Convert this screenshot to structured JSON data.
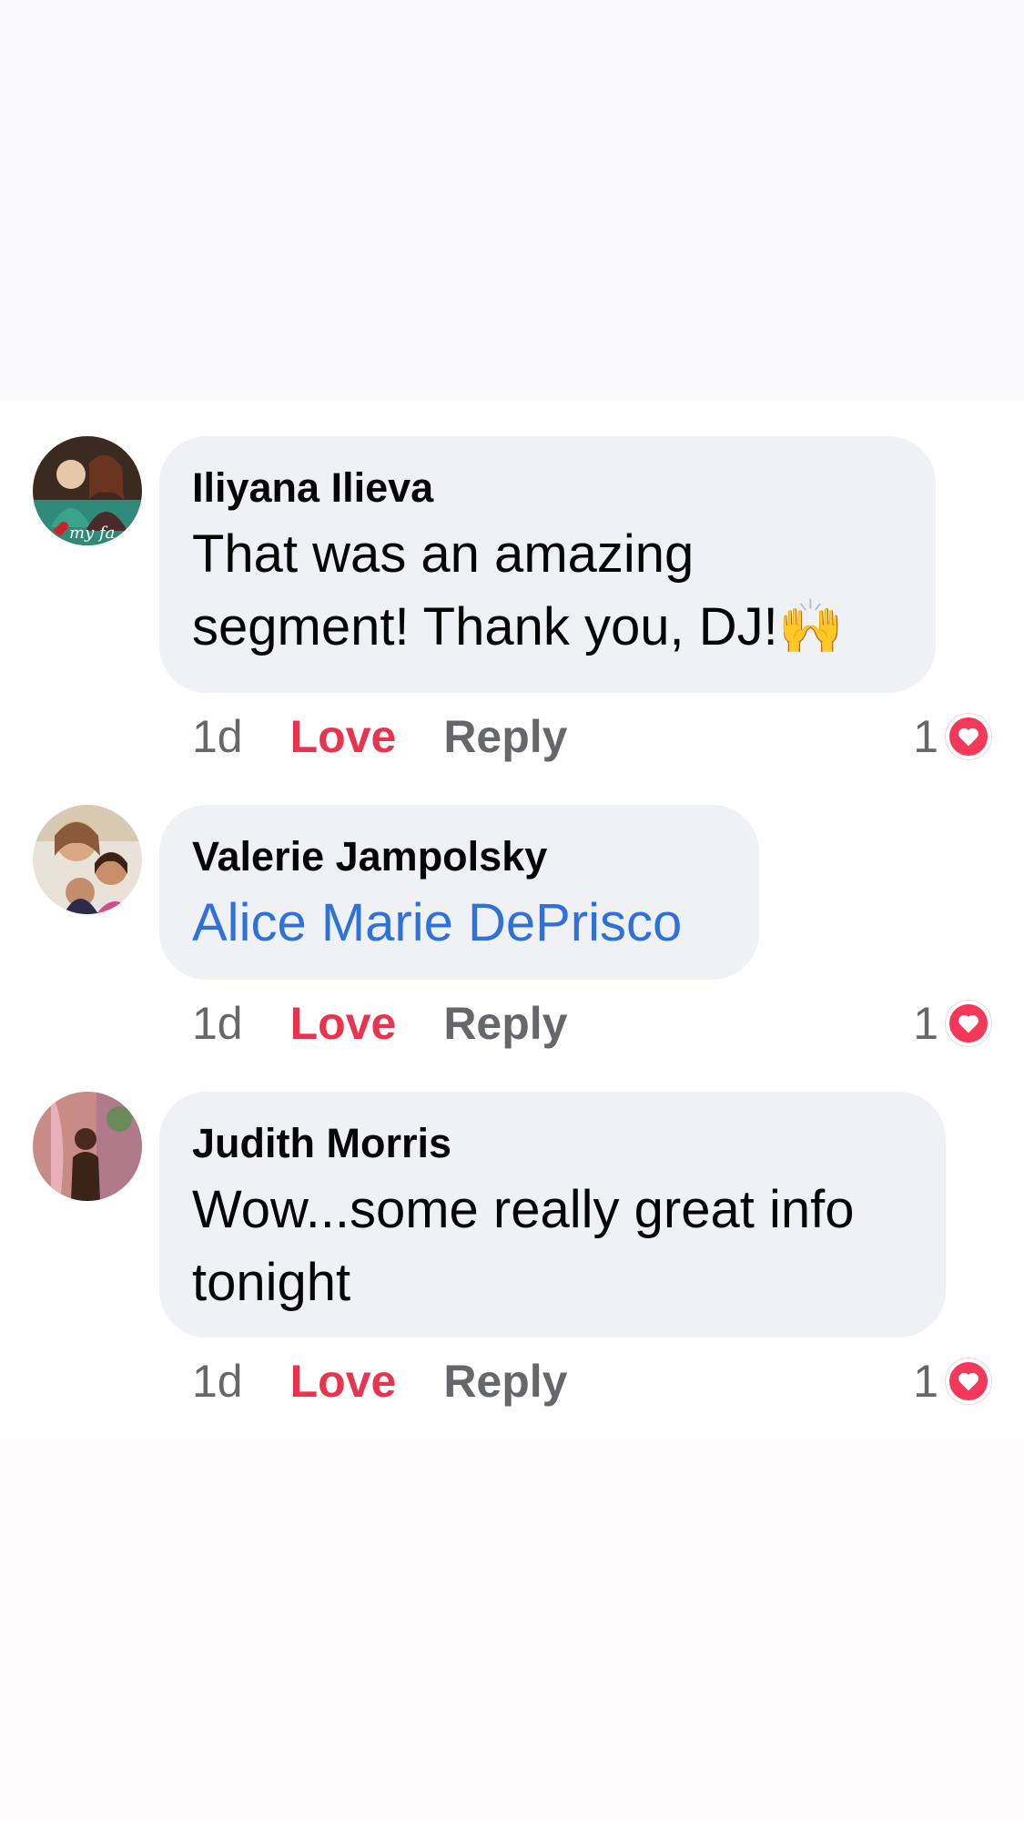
{
  "comments": [
    {
      "author": "Iliyana Ilieva",
      "text": "That was an amazing segment! Thank you, DJ!🙌",
      "time": "1d",
      "love_label": "Love",
      "reply_label": "Reply",
      "reaction_count": "1",
      "reaction_icon": "heart-icon"
    },
    {
      "author": "Valerie Jampolsky",
      "mention": "Alice Marie DePrisco",
      "time": "1d",
      "love_label": "Love",
      "reply_label": "Reply",
      "reaction_count": "1",
      "reaction_icon": "heart-icon"
    },
    {
      "author": "Judith Morris",
      "text": "Wow...some really great info tonight",
      "time": "1d",
      "love_label": "Love",
      "reply_label": "Reply",
      "reaction_count": "1",
      "reaction_icon": "heart-icon"
    }
  ],
  "colors": {
    "bubble": "#f0f1f5",
    "love": "#e8344e",
    "mention": "#2e71d8",
    "muted": "#65676b",
    "heart": "#f3385a"
  }
}
